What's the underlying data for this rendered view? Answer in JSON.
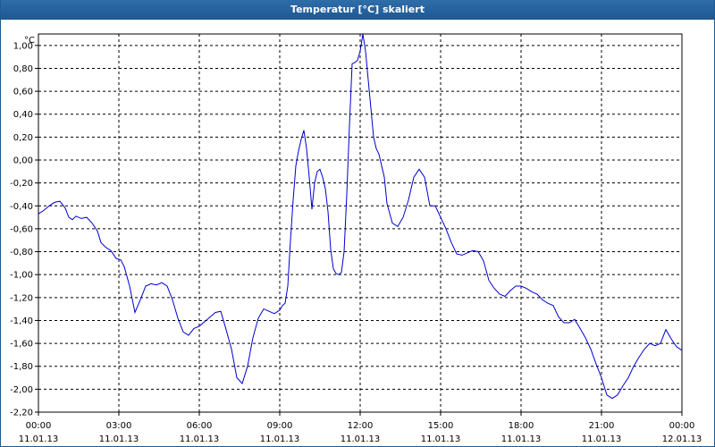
{
  "window": {
    "title": "Temperatur [°C] skaliert"
  },
  "chart_data": {
    "type": "line",
    "title": "Temperatur [°C] skaliert",
    "ylabel": "°C",
    "xlabel": "",
    "xlim": [
      "2013-01-11T00:00",
      "2013-01-12T00:00"
    ],
    "ylim": [
      -2.2,
      1.1
    ],
    "grid": true,
    "y_ticks": [
      "1,00",
      "0,80",
      "0,60",
      "0,40",
      "0,20",
      "0,00",
      "-0,20",
      "-0,40",
      "-0,60",
      "-0,80",
      "-1,00",
      "-1,20",
      "-1,40",
      "-1,60",
      "-1,80",
      "-2,00",
      "-2,20"
    ],
    "x_ticks": [
      {
        "time": "00:00",
        "date": "11.01.13"
      },
      {
        "time": "03:00",
        "date": "11.01.13"
      },
      {
        "time": "06:00",
        "date": "11.01.13"
      },
      {
        "time": "09:00",
        "date": "11.01.13"
      },
      {
        "time": "12:00",
        "date": "11.01.13"
      },
      {
        "time": "15:00",
        "date": "11.01.13"
      },
      {
        "time": "18:00",
        "date": "11.01.13"
      },
      {
        "time": "21:00",
        "date": "11.01.13"
      },
      {
        "time": "00:00",
        "date": "12.01.13"
      }
    ],
    "line_color": "#0000cc",
    "series": [
      {
        "x": [
          "00:00",
          "00:12",
          "00:24",
          "00:36",
          "00:48",
          "01:00",
          "01:08",
          "01:16",
          "01:24",
          "01:36",
          "01:48",
          "02:00",
          "02:12",
          "02:20",
          "02:30",
          "02:42",
          "02:54",
          "03:04",
          "03:12",
          "03:24",
          "03:36",
          "03:48",
          "04:00",
          "04:12",
          "04:24",
          "04:36",
          "04:48",
          "05:00",
          "05:12",
          "05:24",
          "05:36",
          "05:48",
          "06:00",
          "06:12",
          "06:24",
          "06:36",
          "06:48",
          "07:00",
          "07:12",
          "07:24",
          "07:36",
          "07:48",
          "08:00",
          "08:12",
          "08:24",
          "08:36",
          "08:48",
          "09:00",
          "09:06",
          "09:12",
          "09:18",
          "09:24",
          "09:30",
          "09:36",
          "09:42",
          "09:48",
          "09:54",
          "10:00",
          "10:06",
          "10:12",
          "10:18",
          "10:24",
          "10:30",
          "10:36",
          "10:42",
          "10:48",
          "10:54",
          "11:00",
          "11:06",
          "11:12",
          "11:18",
          "11:24",
          "11:30",
          "11:36",
          "11:42",
          "11:48",
          "11:54",
          "12:00",
          "12:06",
          "12:12",
          "12:18",
          "12:24",
          "12:30",
          "12:36",
          "12:42",
          "12:48",
          "12:54",
          "13:00",
          "13:12",
          "13:24",
          "13:36",
          "13:48",
          "14:00",
          "14:12",
          "14:24",
          "14:36",
          "14:48",
          "15:00",
          "15:12",
          "15:24",
          "15:36",
          "15:48",
          "16:00",
          "16:12",
          "16:24",
          "16:36",
          "16:48",
          "17:00",
          "17:12",
          "17:24",
          "17:36",
          "17:48",
          "18:00",
          "18:12",
          "18:24",
          "18:36",
          "18:48",
          "19:00",
          "19:12",
          "19:24",
          "19:36",
          "19:48",
          "20:00",
          "20:12",
          "20:24",
          "20:36",
          "20:48",
          "21:00",
          "21:12",
          "21:24",
          "21:36",
          "21:48",
          "22:00",
          "22:12",
          "22:24",
          "22:36",
          "22:48",
          "23:00",
          "23:12",
          "23:24",
          "23:36",
          "23:48",
          "24:00"
        ],
        "y": [
          -0.47,
          -0.44,
          -0.4,
          -0.37,
          -0.36,
          -0.42,
          -0.5,
          -0.52,
          -0.49,
          -0.51,
          -0.5,
          -0.55,
          -0.62,
          -0.72,
          -0.76,
          -0.79,
          -0.86,
          -0.87,
          -0.93,
          -1.1,
          -1.33,
          -1.22,
          -1.1,
          -1.08,
          -1.09,
          -1.07,
          -1.1,
          -1.22,
          -1.38,
          -1.5,
          -1.53,
          -1.47,
          -1.45,
          -1.41,
          -1.37,
          -1.33,
          -1.32,
          -1.48,
          -1.65,
          -1.9,
          -1.95,
          -1.8,
          -1.55,
          -1.38,
          -1.3,
          -1.32,
          -1.34,
          -1.31,
          -1.27,
          -1.25,
          -1.1,
          -0.7,
          -0.35,
          -0.05,
          0.08,
          0.18,
          0.26,
          0.1,
          -0.15,
          -0.43,
          -0.2,
          -0.1,
          -0.08,
          -0.15,
          -0.25,
          -0.45,
          -0.78,
          -0.95,
          -0.99,
          -1,
          -0.98,
          -0.8,
          -0.3,
          0.3,
          0.84,
          0.85,
          0.87,
          0.95,
          1.1,
          0.95,
          0.7,
          0.45,
          0.2,
          0.1,
          0.05,
          -0.05,
          -0.15,
          -0.38,
          -0.55,
          -0.58,
          -0.5,
          -0.35,
          -0.15,
          -0.08,
          -0.15,
          -0.4,
          -0.4,
          -0.5,
          -0.6,
          -0.72,
          -0.82,
          -0.83,
          -0.81,
          -0.79,
          -0.8,
          -0.88,
          -1.05,
          -1.12,
          -1.17,
          -1.19,
          -1.14,
          -1.1,
          -1.1,
          -1.12,
          -1.15,
          -1.17,
          -1.22,
          -1.25,
          -1.27,
          -1.37,
          -1.42,
          -1.42,
          -1.39,
          -1.47,
          -1.55,
          -1.65,
          -1.78,
          -1.9,
          -2.05,
          -2.08,
          -2.05,
          -1.97,
          -1.9,
          -1.8,
          -1.72,
          -1.65,
          -1.6,
          -1.62,
          -1.6,
          -1.48,
          -1.56,
          -1.63,
          -1.66
        ]
      }
    ]
  }
}
